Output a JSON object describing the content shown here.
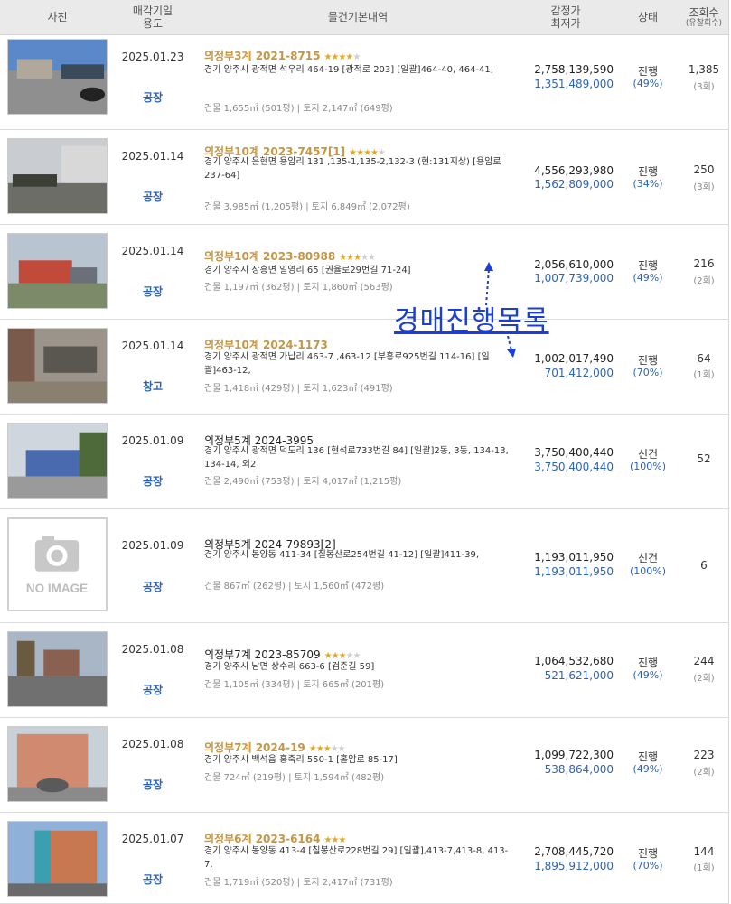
{
  "header": {
    "photo": "사진",
    "date_line1": "매각기일",
    "date_line2": "용도",
    "info": "물건기본내역",
    "price_line1": "감정가",
    "price_line2": "최저가",
    "status": "상태",
    "views_line1": "조회수",
    "views_line2": "(유찰회수)"
  },
  "overlay_text": "경매진행목록",
  "noimage_text": "NO IMAGE",
  "rows": [
    {
      "date": "2025.01.23",
      "usage": "공장",
      "case": "의정부3계 2021-8715",
      "stars": 4,
      "addr": "경기 양주시 광적면 석우리 464-19 [광적로 203]  [일괄]464-40, 464-41,",
      "area": "건물 1,655㎡ (501평)   |   토지 2,147㎡ (649평)",
      "appraisal": "2,758,139,590",
      "minimum": "1,351,489,000",
      "status": "진행",
      "pct": "(49%)",
      "views": "1,385",
      "bids": "(3회)"
    },
    {
      "date": "2025.01.14",
      "usage": "공장",
      "case": "의정부10계 2023-7457[1]",
      "stars": 4,
      "addr": "경기 양주시 은현면 용암리 131 ,135-1,135-2,132-3 (현:131지상) [용암로 237-64]",
      "area": "건물 3,985㎡ (1,205평)   |   토지 6,849㎡ (2,072평)",
      "appraisal": "4,556,293,980",
      "minimum": "1,562,809,000",
      "status": "진행",
      "pct": "(34%)",
      "views": "250",
      "bids": "(3회)"
    },
    {
      "date": "2025.01.14",
      "usage": "공장",
      "case": "의정부10계 2023-80988",
      "stars": 3,
      "addr": "경기 양주시 장흥면 일영리 65 [권율로29번길 71-24]",
      "area": "건물 1,197㎡ (362평)   |   토지 1,860㎡ (563평)",
      "appraisal": "2,056,610,000",
      "minimum": "1,007,739,000",
      "status": "진행",
      "pct": "(49%)",
      "views": "216",
      "bids": "(2회)"
    },
    {
      "date": "2025.01.14",
      "usage": "창고",
      "case": "의정부10계 2024-1173",
      "stars": 0,
      "addr": "경기 양주시 광적면 가납리 463-7 ,463-12 [부흥로925번길 114-16] [일괄]463-12,",
      "area": "건물 1,418㎡ (429평)   |   토지 1,623㎡ (491평)",
      "appraisal": "1,002,017,490",
      "minimum": "701,412,000",
      "status": "진행",
      "pct": "(70%)",
      "views": "64",
      "bids": "(1회)"
    },
    {
      "date": "2025.01.09",
      "usage": "공장",
      "case": "의정부5계 2024-3995",
      "stars": 0,
      "addr": "경기 양주시 광적면 덕도리 136 [현석로733번길 84]  [일괄]2동, 3동, 134-13, 134-14, 외2",
      "area": "건물 2,490㎡ (753평)   |   토지 4,017㎡ (1,215평)",
      "appraisal": "3,750,400,440",
      "minimum": "3,750,400,440",
      "status": "신건",
      "pct": "(100%)",
      "views": "52",
      "bids": ""
    },
    {
      "date": "2025.01.09",
      "usage": "공장",
      "case": "의정부5계 2024-79893[2]",
      "stars": 0,
      "addr": "경기 양주시 봉양동 411-34 [칠봉산로254번길 41-12]  [일괄]411-39,",
      "area": "건물 867㎡ (262평)   |   토지 1,560㎡ (472평)",
      "appraisal": "1,193,011,950",
      "minimum": "1,193,011,950",
      "status": "신건",
      "pct": "(100%)",
      "views": "6",
      "bids": ""
    },
    {
      "date": "2025.01.08",
      "usage": "공장",
      "case": "의정부7계 2023-85709",
      "stars": 3,
      "addr": "경기 양주시 남면 상수리 663-6 [검준길 59]",
      "area": "건물 1,105㎡ (334평)   |   토지 665㎡ (201평)",
      "appraisal": "1,064,532,680",
      "minimum": "521,621,000",
      "status": "진행",
      "pct": "(49%)",
      "views": "244",
      "bids": "(2회)"
    },
    {
      "date": "2025.01.08",
      "usage": "공장",
      "case": "의정부7계 2024-19",
      "stars": 3,
      "addr": "경기 양주시 백석읍 홍죽리 550-1 [홀암로 85-17]",
      "area": "건물 724㎡ (219평)   |   토지 1,594㎡ (482평)",
      "appraisal": "1,099,722,300",
      "minimum": "538,864,000",
      "status": "진행",
      "pct": "(49%)",
      "views": "223",
      "bids": "(2회)"
    },
    {
      "date": "2025.01.07",
      "usage": "공장",
      "case": "의정부6계 2023-6164",
      "stars": 3,
      "addr": "경기 양주시 봉양동 413-4 [칠봉산로228번길 29]  [일괄],413-7,413-8, 413-7,",
      "area": "건물 1,719㎡ (520평)   |   토지 2,417㎡ (731평)",
      "appraisal": "2,708,445,720",
      "minimum": "1,895,912,000",
      "status": "진행",
      "pct": "(70%)",
      "views": "144",
      "bids": "(1회)"
    }
  ]
}
